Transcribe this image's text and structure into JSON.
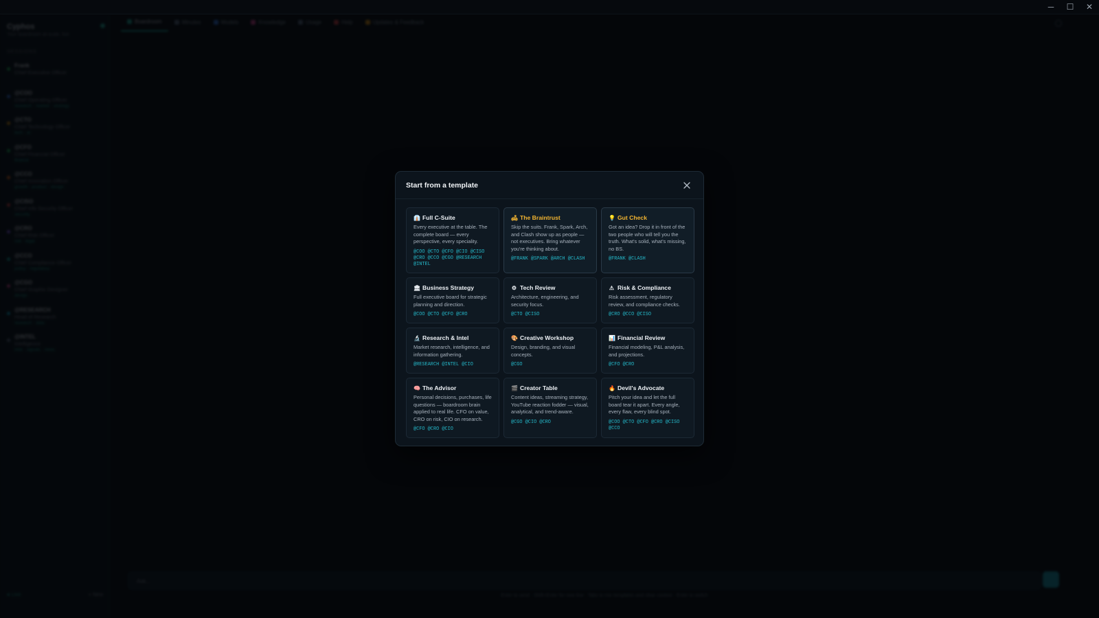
{
  "window": {
    "minimize": "─",
    "maximize": "☐",
    "close": "✕"
  },
  "sidebar": {
    "title": "Cyphos",
    "subtitle": "Your boardroom at-scale, live",
    "section": "SESSIONS",
    "members": [
      {
        "name": "Frank",
        "role": "Chief Executive Officer",
        "meta": "",
        "color": "#22c55e"
      },
      {
        "name": "@COO",
        "role": "Chief Operating Officer",
        "meta": "research · market · strategy",
        "color": "#3b82f6"
      },
      {
        "name": "@CTO",
        "role": "Chief Technology Officer",
        "meta": "tech · ai",
        "color": "#f59e0b"
      },
      {
        "name": "@CFO",
        "role": "Chief Financial Officer",
        "meta": "finance",
        "color": "#22c55e"
      },
      {
        "name": "@CCO",
        "role": "Chief Innovation Officer",
        "meta": "growth · product · design",
        "color": "#f97316"
      },
      {
        "name": "@CISO",
        "role": "Chief Info Security Officer",
        "meta": "security",
        "color": "#ef4444"
      },
      {
        "name": "@CRO",
        "role": "Chief Risk Officer",
        "meta": "risk · legal",
        "color": "#8b5cf6"
      },
      {
        "name": "@CCO",
        "role": "Chief Compliance Officer",
        "meta": "policy · regulatory",
        "color": "#14b8a6"
      },
      {
        "name": "@CGO",
        "role": "Chief Graphic Designer",
        "meta": "design",
        "color": "#ec4899"
      },
      {
        "name": "@RESEARCH",
        "role": "Head of Research",
        "meta": "research · data",
        "color": "#06b6d4"
      },
      {
        "name": "@INTEL",
        "role": "Intelligence",
        "meta": "intel · signals · news",
        "color": "#64748b"
      }
    ],
    "footer_left": "● Live",
    "footer_right": "+ New"
  },
  "tabs": [
    {
      "label": "Boardroom",
      "color": "#1fb9a2",
      "active": true
    },
    {
      "label": "Minutes",
      "color": "#64748b",
      "active": false
    },
    {
      "label": "Models",
      "color": "#3b82f6",
      "active": false
    },
    {
      "label": "Knowledge",
      "color": "#ec4899",
      "active": false
    },
    {
      "label": "Usage",
      "color": "#64748b",
      "active": false
    },
    {
      "label": "Help",
      "color": "#ef4444",
      "active": false
    },
    {
      "label": "Updates & Feedback",
      "color": "#f59e0b",
      "active": false
    }
  ],
  "composer": {
    "placeholder": "Ask...",
    "hint": "Enter to send · Shift+Enter for new line · Tabs to mix templates and clear context · Enter to switch"
  },
  "modal": {
    "title": "Start from a template",
    "templates": [
      {
        "icon": "👔",
        "title": "Full C-Suite",
        "desc": "Every executive at the table. The complete board — every perspective, every speciality.",
        "tags": "@COO @CTO @CFO @CIO @CISO @CRO @CCO @CGO @RESEARCH @INTEL",
        "gold": false,
        "highlight": false
      },
      {
        "icon": "🛋",
        "title": "The Braintrust",
        "desc": "Skip the suits. Frank, Spark, Arch, and Clash show up as people — not executives. Bring whatever you're thinking about.",
        "tags": "@FRANK @SPARK @ARCH @CLASH",
        "gold": true,
        "highlight": true
      },
      {
        "icon": "💡",
        "title": "Gut Check",
        "desc": "Got an idea? Drop it in front of the two people who will tell you the truth. What's solid, what's missing, no BS.",
        "tags": "@FRANK @CLASH",
        "gold": true,
        "highlight": true
      },
      {
        "icon": "🏛",
        "title": "Business Strategy",
        "desc": "Full executive board for strategic planning and direction.",
        "tags": "@COO @CTO @CFO @CRO",
        "gold": false,
        "highlight": false
      },
      {
        "icon": "⚙",
        "title": "Tech Review",
        "desc": "Architecture, engineering, and security focus.",
        "tags": "@CTO @CISO",
        "gold": false,
        "highlight": false
      },
      {
        "icon": "⚠",
        "title": "Risk & Compliance",
        "desc": "Risk assessment, regulatory review, and compliance checks.",
        "tags": "@CRO @CCO @CISO",
        "gold": false,
        "highlight": false
      },
      {
        "icon": "🔬",
        "title": "Research & Intel",
        "desc": "Market research, intelligence, and information gathering.",
        "tags": "@RESEARCH @INTEL @CIO",
        "gold": false,
        "highlight": false
      },
      {
        "icon": "🎨",
        "title": "Creative Workshop",
        "desc": "Design, branding, and visual concepts.",
        "tags": "@CGO",
        "gold": false,
        "highlight": false
      },
      {
        "icon": "📊",
        "title": "Financial Review",
        "desc": "Financial modeling, P&L analysis, and projections.",
        "tags": "@CFO @CRO",
        "gold": false,
        "highlight": false
      },
      {
        "icon": "🧠",
        "title": "The Advisor",
        "desc": "Personal decisions, purchases, life questions — boardroom brain applied to real life. CFO on value, CRO on risk, CIO on research.",
        "tags": "@CFO @CRO @CIO",
        "gold": false,
        "highlight": false
      },
      {
        "icon": "🎬",
        "title": "Creator Table",
        "desc": "Content ideas, streaming strategy, YouTube reaction fodder — visual, analytical, and trend-aware.",
        "tags": "@CGO @CIO @CRO",
        "gold": false,
        "highlight": false
      },
      {
        "icon": "🔥",
        "title": "Devil's Advocate",
        "desc": "Pitch your idea and let the full board tear it apart. Every angle, every flaw, every blind spot.",
        "tags": "@COO @CTO @CFO @CRO @CISO @CCO",
        "gold": false,
        "highlight": false
      }
    ]
  }
}
